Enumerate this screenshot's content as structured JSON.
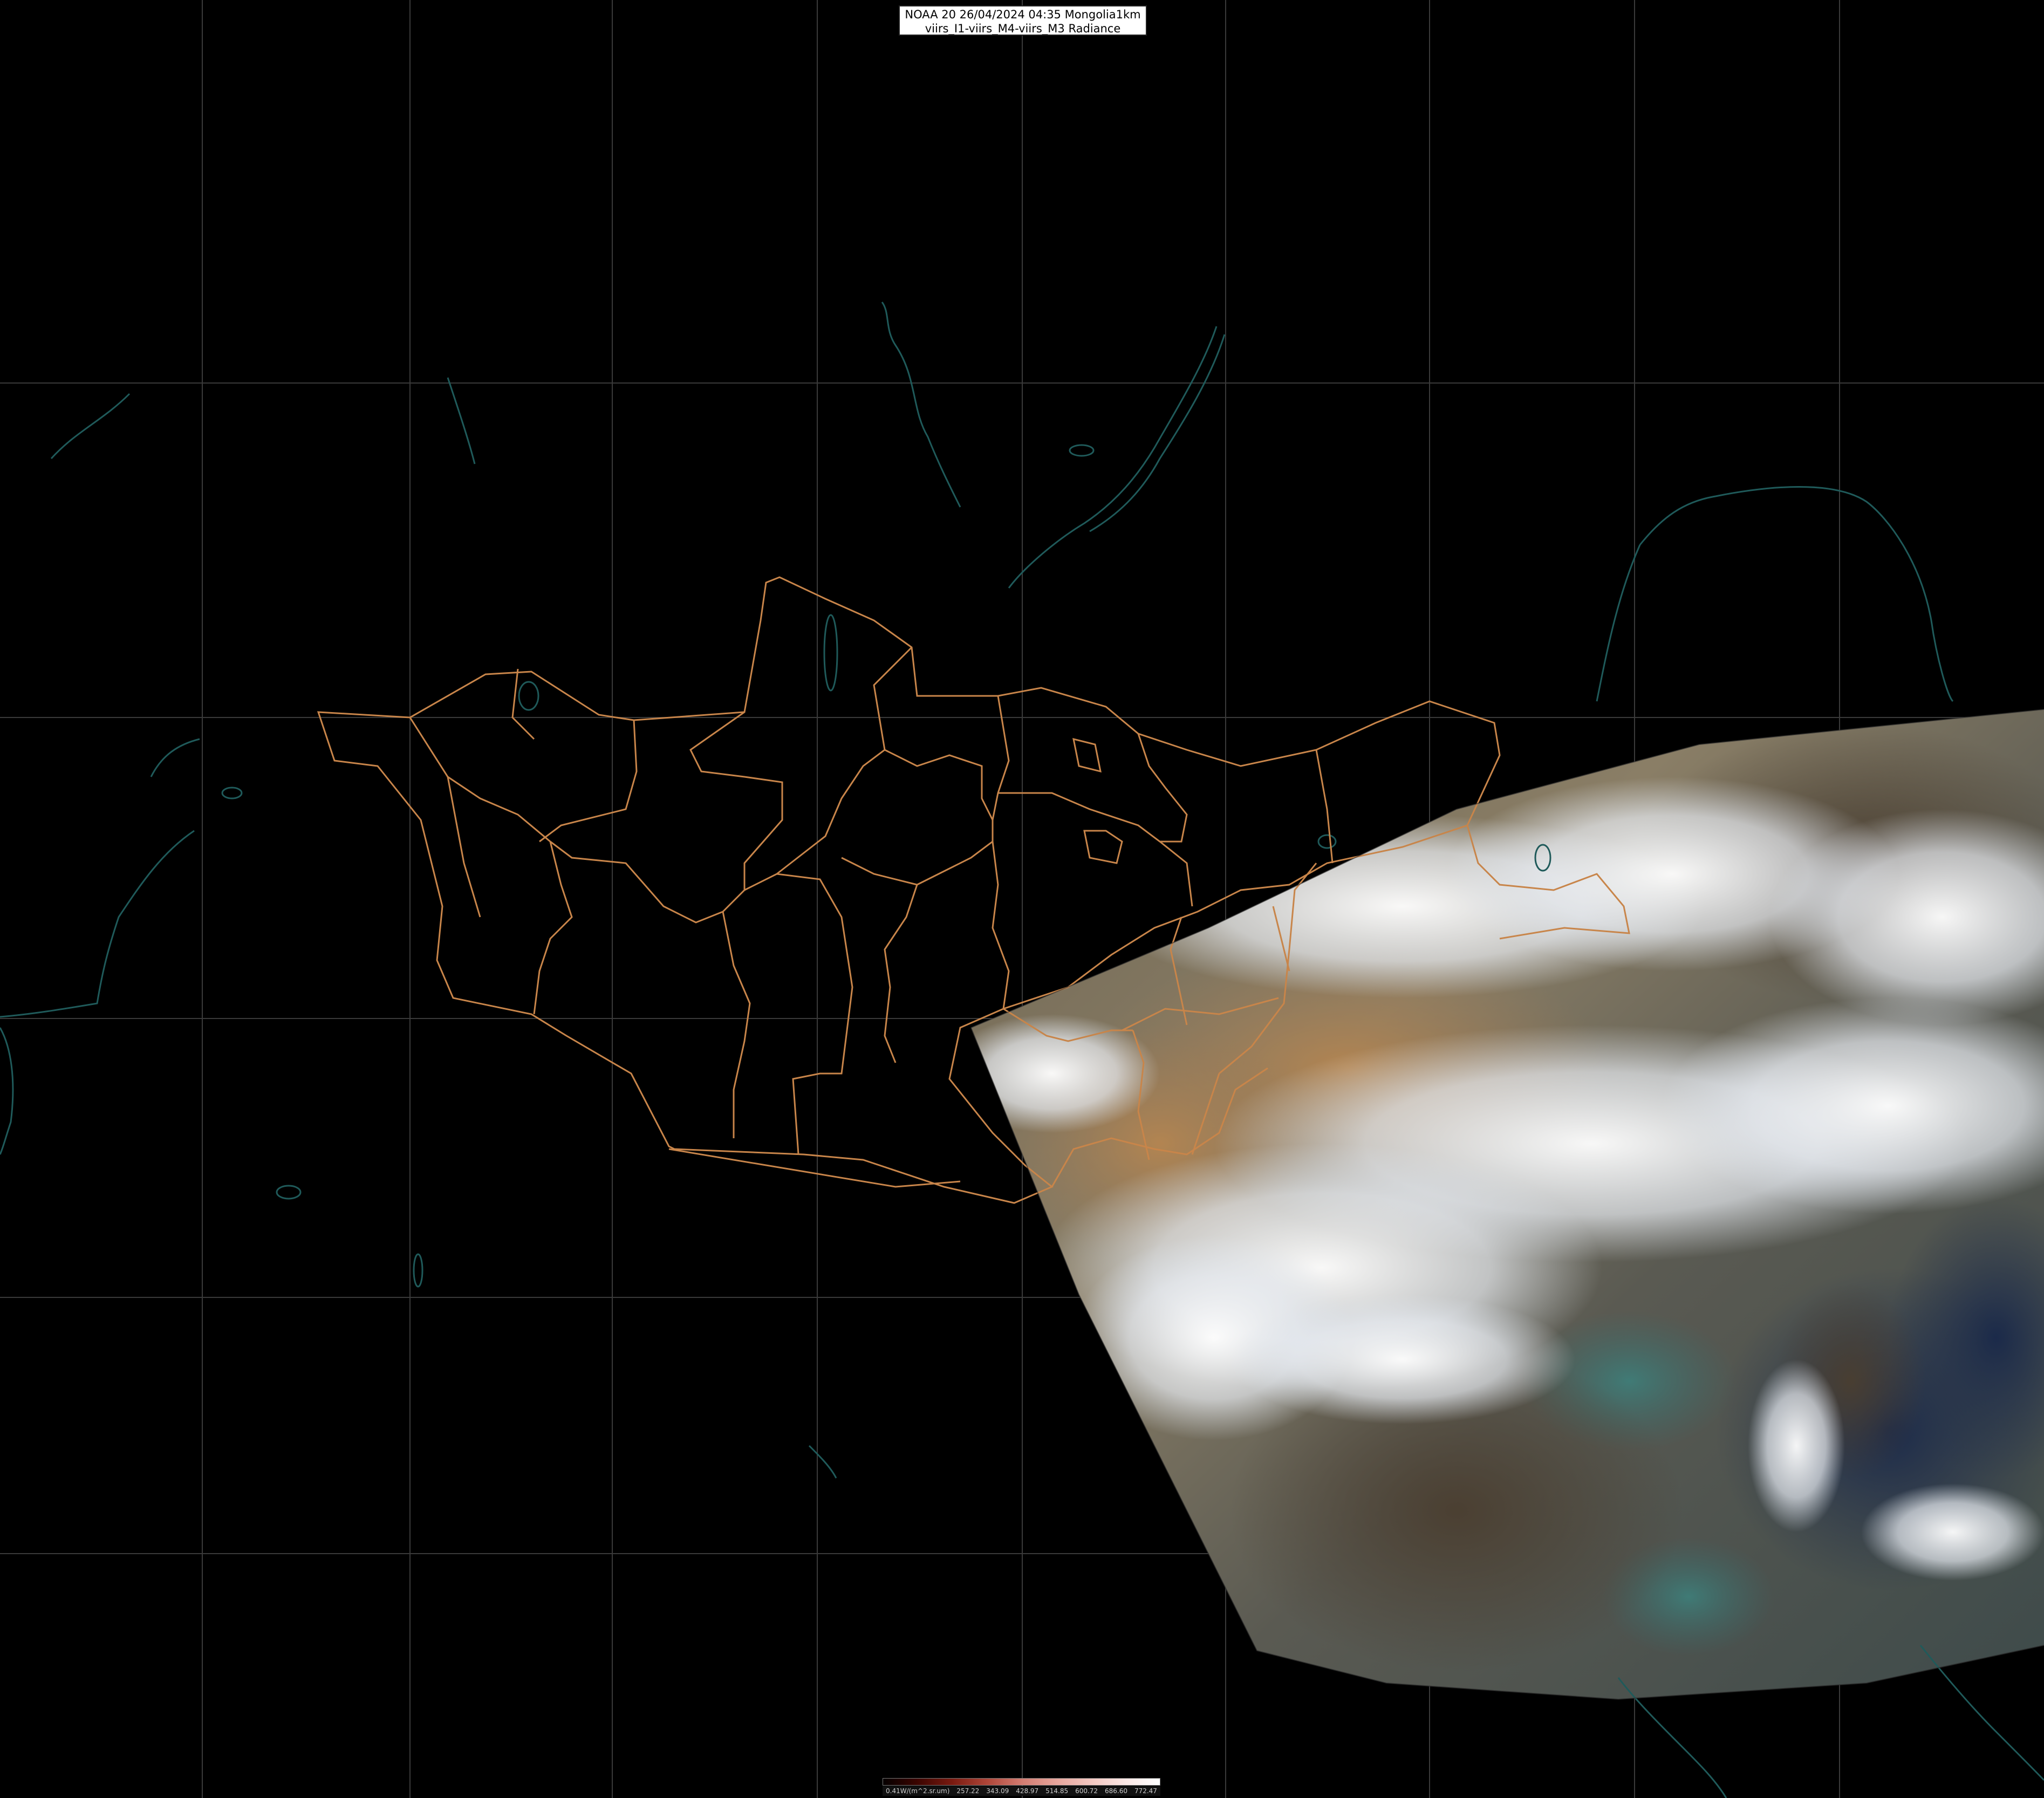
{
  "title": {
    "line1": "NOAA 20 26/04/2024 04:35 Mongolia1km",
    "line2": "viirs_I1-viirs_M4-viirs_M3 Radiance"
  },
  "colorbar": {
    "labels": [
      "0.41W/(m^2.sr.um)",
      "257.22",
      "343.09",
      "428.97",
      "514.85",
      "600.72",
      "686.60",
      "772.47"
    ]
  },
  "colors": {
    "background": "#000000",
    "border_lines": "#c8854a",
    "coast_lines": "#1f5a5a",
    "graticule": "#3a3a3a"
  }
}
